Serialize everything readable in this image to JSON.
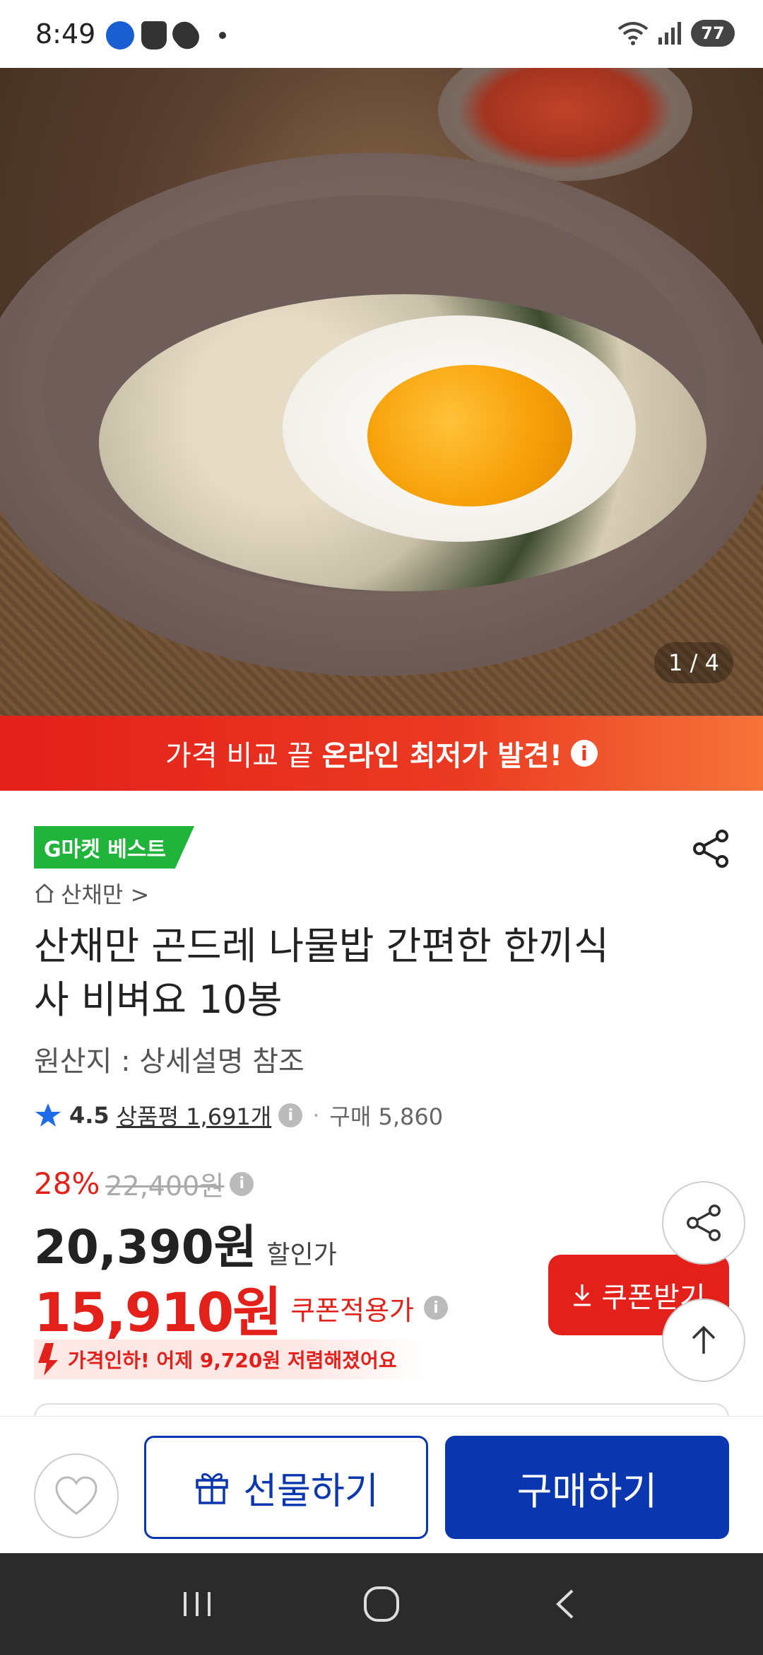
{
  "status_bar": {
    "time": "8:49",
    "battery": "77"
  },
  "hero": {
    "page_indicator": "1 / 4"
  },
  "promo": {
    "text_regular": "가격 비교 끝",
    "text_bold": "온라인 최저가 발견!",
    "info_glyph": "i"
  },
  "product": {
    "badge": "G마켓 베스트",
    "store": "산채만 >",
    "title": "산채만 곤드레 나물밥 간편한 한끼식사 비벼요 10봉",
    "origin": "원산지 : 상세설명 참조",
    "rating": "4.5",
    "review_label": "상품평 1,691개",
    "purchase": "구매 5,860"
  },
  "price": {
    "discount_rate": "28%",
    "original": "22,400원",
    "sale": "20,390원",
    "sale_label": "할인가",
    "coupon_price": "15,910원",
    "coupon_label": "쿠폰적용가",
    "price_drop": "가격인하! 어제 9,720원 저렴해졌어요"
  },
  "buttons": {
    "coupon": "쿠폰받기",
    "gift": "선물하기",
    "buy": "구매하기"
  },
  "icons": {
    "share": "share-icon",
    "scroll_top": "arrow-up-icon",
    "wish": "heart-icon",
    "gift": "gift-icon",
    "download": "download-icon",
    "star": "star-icon",
    "home": "home-icon"
  },
  "colors": {
    "accent_red": "#e4201b",
    "brand_blue": "#0a36b0",
    "badge_green": "#20b43a"
  }
}
